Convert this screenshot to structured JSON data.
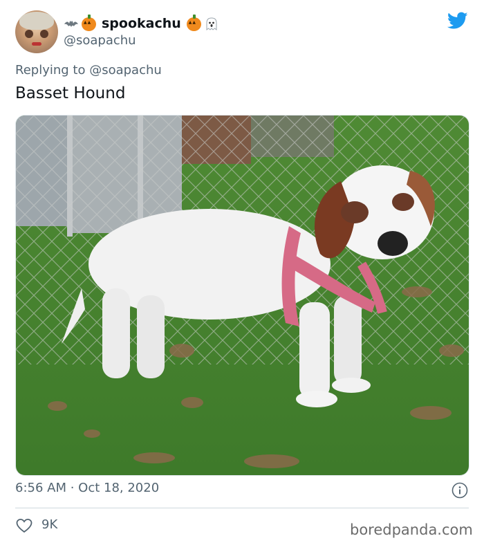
{
  "tweet": {
    "display_name": "spookachu",
    "handle": "@soapachu",
    "reply_to": "Replying to @soapachu",
    "text": "Basset Hound",
    "timestamp": "6:56 AM · Oct 18, 2020",
    "like_count": "9K",
    "photo_alt": "Basset Hound"
  },
  "icons": {
    "name_prefix": [
      "bat-icon",
      "pumpkin-icon"
    ],
    "name_suffix": [
      "pumpkin-icon",
      "ghost-icon"
    ],
    "brand": "twitter-bird-icon",
    "info": "info-icon",
    "like": "heart-icon"
  },
  "watermark": "boredpanda.com",
  "colors": {
    "twitter_blue": "#1d9bf0",
    "secondary_text": "#536471",
    "primary_text": "#0f1419",
    "divider": "#cfd9de"
  }
}
